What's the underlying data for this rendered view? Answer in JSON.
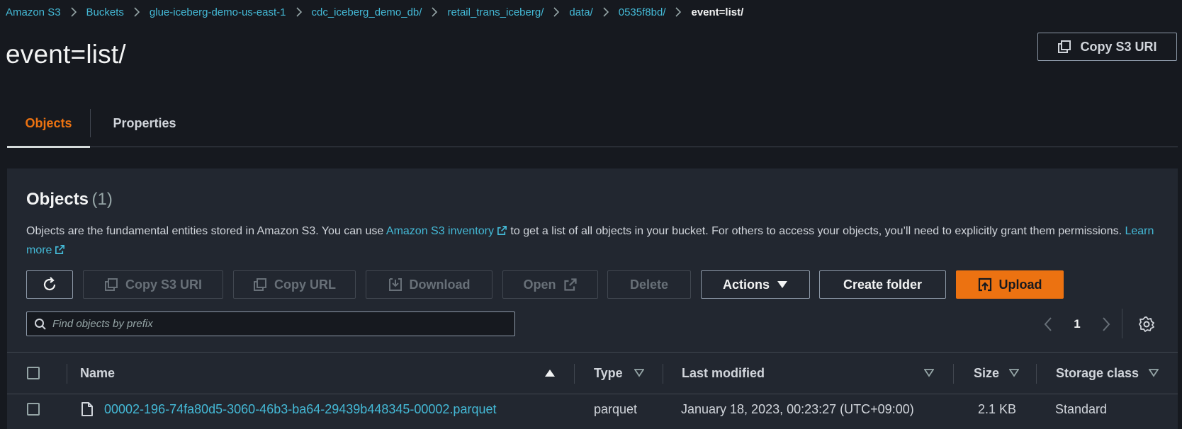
{
  "breadcrumb": [
    {
      "label": "Amazon S3"
    },
    {
      "label": "Buckets"
    },
    {
      "label": "glue-iceberg-demo-us-east-1"
    },
    {
      "label": "cdc_iceberg_demo_db/"
    },
    {
      "label": "retail_trans_iceberg/"
    },
    {
      "label": "data/"
    },
    {
      "label": "0535f8bd/"
    },
    {
      "label": "event=list/"
    }
  ],
  "page_title": "event=list/",
  "header_actions": {
    "copy_s3_uri": "Copy S3 URI"
  },
  "tabs": [
    {
      "label": "Objects",
      "active": true
    },
    {
      "label": "Properties",
      "active": false
    }
  ],
  "objects_panel": {
    "title": "Objects",
    "count": "(1)",
    "description_prefix": "Objects are the fundamental entities stored in Amazon S3. You can use ",
    "inventory_link": "Amazon S3 inventory",
    "description_middle": " to get a list of all objects in your bucket. For others to access your objects, you’ll need to explicitly grant them permissions. ",
    "learn_more_link": "Learn more"
  },
  "toolbar": {
    "copy_s3_uri": "Copy S3 URI",
    "copy_url": "Copy URL",
    "download": "Download",
    "open": "Open",
    "delete": "Delete",
    "actions": "Actions",
    "create_folder": "Create folder",
    "upload": "Upload"
  },
  "search": {
    "placeholder": "Find objects by prefix",
    "value": ""
  },
  "pagination": {
    "current_page": "1"
  },
  "table": {
    "columns": {
      "name": "Name",
      "type": "Type",
      "last_modified": "Last modified",
      "size": "Size",
      "storage_class": "Storage class"
    },
    "rows": [
      {
        "name": "00002-196-74fa80d5-3060-46b3-ba64-29439b448345-00002.parquet",
        "type": "parquet",
        "last_modified": "January 18, 2023, 00:23:27 (UTC+09:00)",
        "size": "2.1 KB",
        "storage_class": "Standard"
      }
    ]
  },
  "colors": {
    "background": "#16191f",
    "panel": "#222730",
    "link": "#44b9d6",
    "accent": "#ec7211",
    "border": "#414750"
  },
  "icons": {
    "breadcrumb_separator": "chevron-right-icon",
    "copy": "copy-icon",
    "refresh": "refresh-icon",
    "download": "download-icon",
    "external": "external-link-icon",
    "dropdown": "caret-down-icon",
    "upload": "upload-icon",
    "search": "search-icon",
    "settings": "gear-icon",
    "file": "file-icon",
    "sort": "sort-icon"
  }
}
